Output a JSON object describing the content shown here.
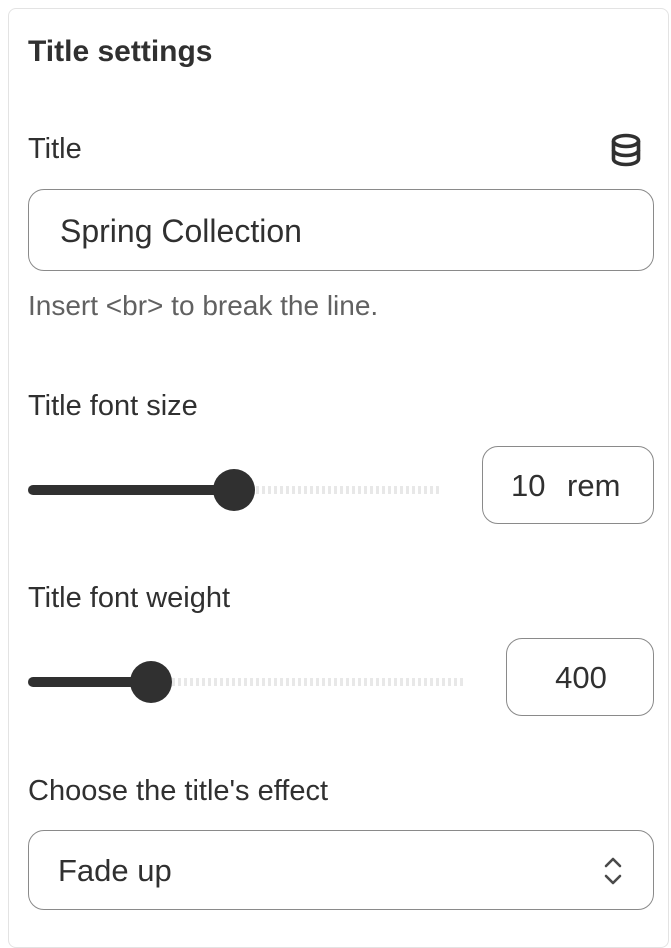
{
  "panel": {
    "heading": "Title settings"
  },
  "title_field": {
    "label": "Title",
    "icon": "database-icon",
    "value": "Spring Collection",
    "help": "Insert <br> to break the line."
  },
  "font_size": {
    "label": "Title font size",
    "value": "10",
    "unit": "rem",
    "slider_fraction": 0.5
  },
  "font_weight": {
    "label": "Title font weight",
    "value": "400",
    "slider_fraction": 0.28
  },
  "effect": {
    "label": "Choose the title's effect",
    "selected": "Fade up",
    "icon": "select-chevrons-icon"
  },
  "colors": {
    "text": "#303030",
    "muted": "#616161",
    "border": "#8a8a8a",
    "slider_fill": "#303030"
  }
}
